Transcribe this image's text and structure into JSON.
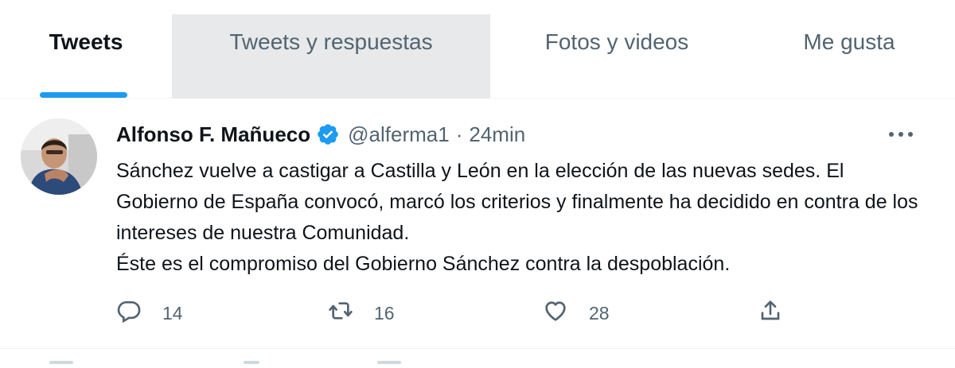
{
  "tabs": [
    {
      "label": "Tweets"
    },
    {
      "label": "Tweets y respuestas"
    },
    {
      "label": "Fotos y videos"
    },
    {
      "label": "Me gusta"
    }
  ],
  "tweet": {
    "author_name": "Alfonso F. Mañueco",
    "handle": "@alferma1",
    "separator": "·",
    "time": "24min",
    "text": "Sánchez vuelve a castigar a Castilla y León en la elección de las nuevas sedes. El Gobierno de España convocó, marcó los criterios y finalmente ha decidido en contra de los intereses de nuestra Comunidad.\nÉste es el compromiso del Gobierno Sánchez contra la despoblación.",
    "replies": "14",
    "retweets": "16",
    "likes": "28"
  },
  "colors": {
    "accent": "#1d9bf0",
    "secondary_text": "#536471",
    "tab_hover_bg": "#e7e9ea"
  },
  "icons": {
    "verified": "verified-badge-icon",
    "more": "more-options-icon",
    "reply": "reply-icon",
    "retweet": "retweet-icon",
    "like": "heart-icon",
    "share": "share-icon"
  }
}
